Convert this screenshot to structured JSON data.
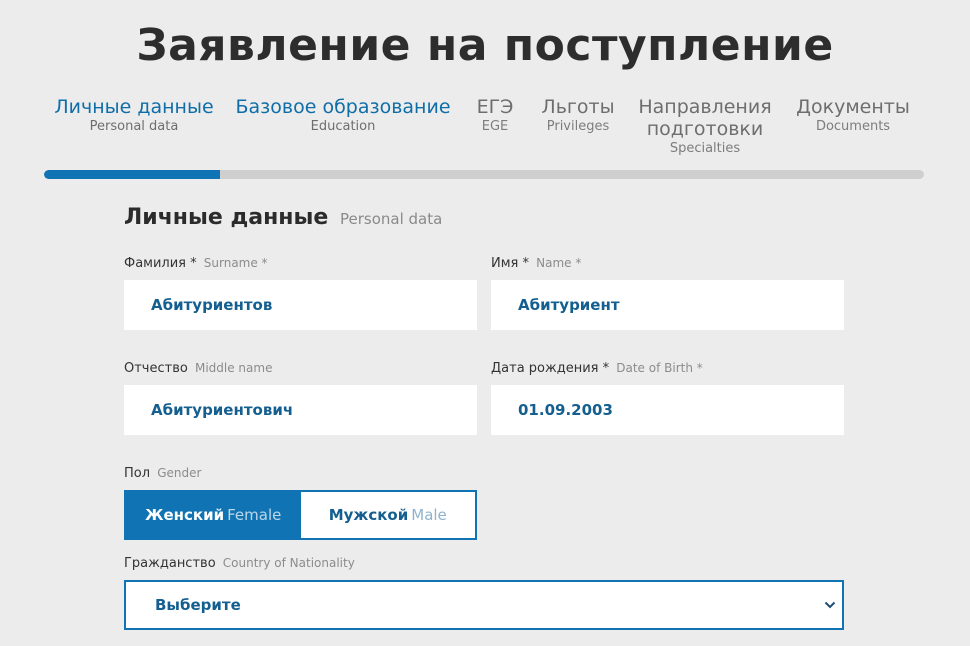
{
  "page_title": "Заявление на поступление",
  "steps": [
    {
      "ru": "Личные данные",
      "en": "Personal data",
      "active": true
    },
    {
      "ru": "Базовое образование",
      "en": "Education",
      "active": true
    },
    {
      "ru": "ЕГЭ",
      "en": "EGE",
      "active": false
    },
    {
      "ru": "Льготы",
      "en": "Privileges",
      "active": false
    },
    {
      "ru": "Направления",
      "ru2": "подготовки",
      "en": "Specialties",
      "active": false
    },
    {
      "ru": "Документы",
      "en": "Documents",
      "active": false
    }
  ],
  "progress": 0.2,
  "colors": {
    "accent": "#1074b4",
    "background": "#ececec"
  },
  "section": {
    "title_ru": "Личные данные",
    "title_en": "Personal data"
  },
  "fields": {
    "surname": {
      "label_ru": "Фамилия *",
      "label_en": "Surname *",
      "value": "Абитуриентов"
    },
    "name": {
      "label_ru": "Имя *",
      "label_en": "Name *",
      "value": "Абитуриент"
    },
    "middle_name": {
      "label_ru": "Отчество",
      "label_en": "Middle name",
      "value": "Абитуриентович"
    },
    "birth_date": {
      "label_ru": "Дата рождения *",
      "label_en": "Date of Birth *",
      "value": "01.09.2003"
    }
  },
  "gender": {
    "label_ru": "Пол",
    "label_en": "Gender",
    "female_ru": "Женский",
    "female_en": "Female",
    "male_ru": "Мужской",
    "male_en": "Male",
    "selected": "female"
  },
  "citizenship": {
    "label_ru": "Гражданство",
    "label_en": "Country of Nationality",
    "value": "Выберите",
    "icon": "chevron-down-icon"
  }
}
